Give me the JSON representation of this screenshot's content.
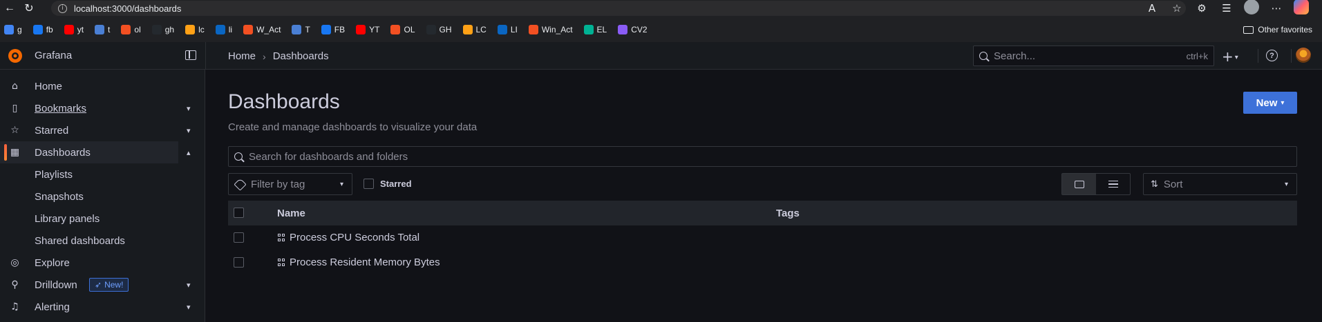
{
  "browser": {
    "url": "localhost:3000/dashboards",
    "bookmarks": [
      {
        "label": "g",
        "color": "#4285f4"
      },
      {
        "label": "fb",
        "color": "#1877f2"
      },
      {
        "label": "yt",
        "color": "#ff0000"
      },
      {
        "label": "t",
        "color": "#4a7fd4"
      },
      {
        "label": "ol",
        "color": "#f25022"
      },
      {
        "label": "gh",
        "color": "#24292e"
      },
      {
        "label": "lc",
        "color": "#ffa116"
      },
      {
        "label": "li",
        "color": "#0a66c2"
      },
      {
        "label": "W_Act",
        "color": "#f25022"
      },
      {
        "label": "T",
        "color": "#4a7fd4"
      },
      {
        "label": "FB",
        "color": "#1877f2"
      },
      {
        "label": "YT",
        "color": "#ff0000"
      },
      {
        "label": "OL",
        "color": "#f25022"
      },
      {
        "label": "GH",
        "color": "#24292e"
      },
      {
        "label": "LC",
        "color": "#ffa116"
      },
      {
        "label": "LI",
        "color": "#0a66c2"
      },
      {
        "label": "Win_Act",
        "color": "#f25022"
      },
      {
        "label": "EL",
        "color": "#00b294"
      },
      {
        "label": "CV2",
        "color": "#8a5cf6"
      }
    ],
    "other_favorites": "Other favorites"
  },
  "app": {
    "name": "Grafana",
    "breadcrumb": {
      "home": "Home",
      "current": "Dashboards"
    },
    "search_placeholder": "Search...",
    "search_shortcut": "ctrl+k",
    "accent": "#f55f3e"
  },
  "sidebar": {
    "items": [
      {
        "label": "Home",
        "icon": "home-icon"
      },
      {
        "label": "Bookmarks",
        "icon": "bookmark-icon"
      },
      {
        "label": "Starred",
        "icon": "star-icon"
      },
      {
        "label": "Dashboards",
        "icon": "apps-icon"
      },
      {
        "label": "Playlists"
      },
      {
        "label": "Snapshots"
      },
      {
        "label": "Library panels"
      },
      {
        "label": "Shared dashboards"
      },
      {
        "label": "Explore",
        "icon": "compass-icon"
      },
      {
        "label": "Drilldown",
        "icon": "drilldown-icon",
        "badge": "New!"
      },
      {
        "label": "Alerting",
        "icon": "bell-icon"
      }
    ]
  },
  "main": {
    "title": "Dashboards",
    "subtitle": "Create and manage dashboards to visualize your data",
    "new_button": "New",
    "search_placeholder": "Search for dashboards and folders",
    "tag_filter_placeholder": "Filter by tag",
    "starred_label": "Starred",
    "sort_placeholder": "Sort",
    "table": {
      "headers": {
        "name": "Name",
        "tags": "Tags"
      },
      "rows": [
        {
          "name": "Process CPU Seconds Total"
        },
        {
          "name": "Process Resident Memory Bytes"
        }
      ]
    }
  }
}
